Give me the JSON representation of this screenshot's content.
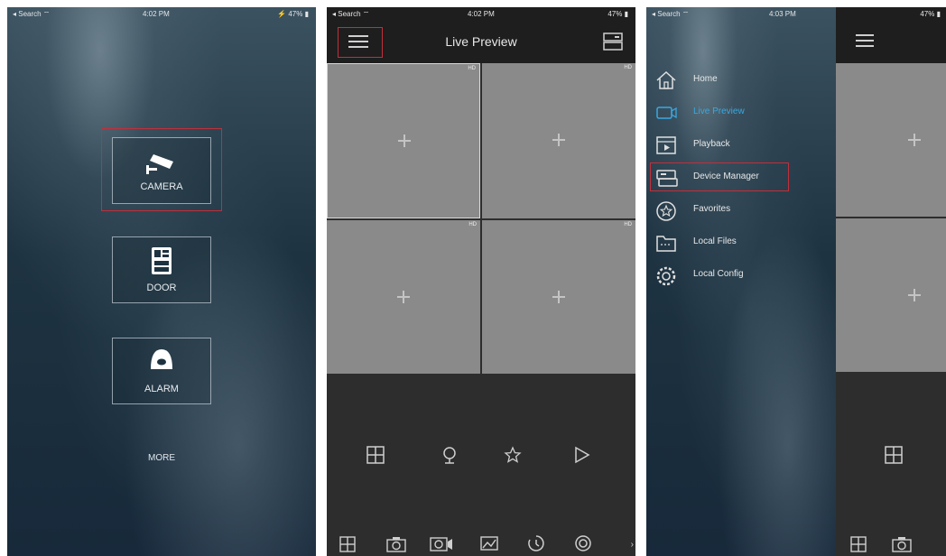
{
  "screens": {
    "home": {
      "status": {
        "left": "◂ Search ⌔",
        "time": "4:02 PM",
        "right": "⚡ 47% ▮"
      },
      "tiles": [
        {
          "label": "CAMERA",
          "icon": "cctv-camera-icon"
        },
        {
          "label": "DOOR",
          "icon": "door-intercom-icon"
        },
        {
          "label": "ALARM",
          "icon": "alarm-sensor-icon"
        }
      ],
      "more_label": "MORE"
    },
    "live_preview": {
      "status": {
        "left": "◂ Search ⌔",
        "time": "4:02 PM",
        "right": "47% ▮"
      },
      "title": "Live Preview",
      "quality_labels": [
        "HD",
        "HD",
        "HD",
        "HD"
      ],
      "controls": [
        "split-screen-icon",
        "ptz-icon",
        "favorite-star-icon",
        "play-icon"
      ],
      "toolbar": [
        "multi-window-icon",
        "snapshot-icon",
        "record-icon",
        "image-quality-icon",
        "playback-icon",
        "settings-icon"
      ]
    },
    "side_menu": {
      "status": {
        "left": "◂ Search ⌔",
        "time": "4:03 PM",
        "right": "47% ▮"
      },
      "menu": [
        {
          "label": "Home",
          "icon": "home-icon"
        },
        {
          "label": "Live Preview",
          "icon": "live-preview-icon",
          "active": true
        },
        {
          "label": "Playback",
          "icon": "playback-icon"
        },
        {
          "label": "Device Manager",
          "icon": "device-manager-icon"
        },
        {
          "label": "Favorites",
          "icon": "favorites-icon"
        },
        {
          "label": "Local Files",
          "icon": "local-files-icon"
        },
        {
          "label": "Local Config",
          "icon": "local-config-icon"
        }
      ]
    }
  },
  "colors": {
    "highlight": "#c0303b",
    "active": "#3aa8e0",
    "panel_dark": "#1e1e1e",
    "grid": "#8a8a8a"
  }
}
